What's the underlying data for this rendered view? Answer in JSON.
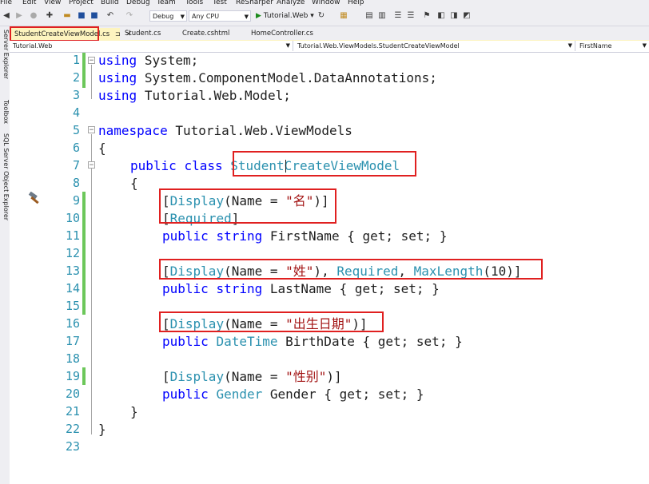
{
  "menu": [
    "File",
    "Edit",
    "View",
    "Project",
    "Build",
    "Debug",
    "Team",
    "Tools",
    "Test",
    "ReSharper",
    "Analyze",
    "Window",
    "Help"
  ],
  "toolbar": {
    "config": "Debug",
    "platform": "Any CPU",
    "start_label": "Tutorial.Web"
  },
  "side_tools": [
    "Server Explorer",
    "Toolbox",
    "SQL Server Object Explorer"
  ],
  "tabs": [
    {
      "label": "StudentCreateViewModel.cs",
      "pin": "⊐",
      "close": "✕"
    },
    {
      "label": "Student.cs"
    },
    {
      "label": "Create.cshtml"
    },
    {
      "label": "HomeController.cs"
    }
  ],
  "nav": {
    "project": "Tutorial.Web",
    "type": "Tutorial.Web.ViewModels.StudentCreateViewModel",
    "member": "FirstName"
  },
  "line_numbers": [
    "1",
    "2",
    "3",
    "4",
    "5",
    "6",
    "7",
    "8",
    "9",
    "10",
    "11",
    "12",
    "13",
    "14",
    "15",
    "16",
    "17",
    "18",
    "19",
    "20",
    "21",
    "22",
    "23"
  ],
  "code": {
    "using": "using",
    "system": "System;",
    "dataann": "System.ComponentModel.DataAnnotations;",
    "model": "Tutorial.Web.Model;",
    "namespace": "namespace",
    "ns_name": "Tutorial.Web.ViewModels",
    "brace_open": "{",
    "brace_close": "}",
    "public": "public",
    "class": "class",
    "class_name": "StudentCreateViewModel",
    "display": "Display",
    "name_eq": "(Name = ",
    "s_ming": "\"名\"",
    "s_xing": "\"姓\"",
    "s_birth": "\"出生日期\"",
    "s_gender": "\"性别\"",
    "required": "Required",
    "maxlength": "MaxLength",
    "string": "string",
    "datetime": "DateTime",
    "gender_type": "Gender",
    "firstname": "FirstName",
    "lastname": "LastName",
    "birthdate": "BirthDate",
    "gender_prop": "Gender",
    "getset": "{ get; set; }",
    "lbr": "[",
    "rbr": "]",
    "close_attr": ")]",
    "comma_sp": ", ",
    "paren10": "(10)"
  }
}
